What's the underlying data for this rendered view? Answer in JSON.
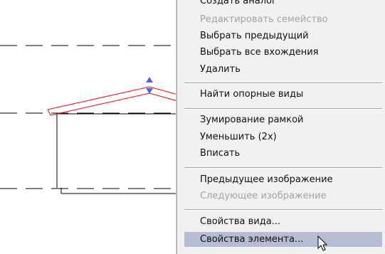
{
  "menu": {
    "items": [
      {
        "label": "Создать аналог",
        "enabled": true
      },
      {
        "label": "Редактировать семейство",
        "enabled": false
      },
      {
        "label": "Выбрать предыдущий",
        "enabled": true
      },
      {
        "label": "Выбрать все вхождения",
        "enabled": true
      },
      {
        "label": "Удалить",
        "enabled": true
      },
      {
        "label": "Найти опорные виды",
        "enabled": true
      },
      {
        "label": "Зумирование рамкой",
        "enabled": true
      },
      {
        "label": "Уменьшить (2x)",
        "enabled": true
      },
      {
        "label": "Вписать",
        "enabled": true
      },
      {
        "label": "Предыдущее изображение",
        "enabled": true
      },
      {
        "label": "Следующее изображение",
        "enabled": false
      },
      {
        "label": "Свойства вида...",
        "enabled": true
      },
      {
        "label": "Свойства элемента...",
        "enabled": true,
        "highlighted": true
      }
    ]
  },
  "colors": {
    "selection_outline": "#ff0000",
    "grip_arrow": "#4a66e0",
    "menu_background": "#f1f1ef",
    "menu_highlight": "#b6bdd2",
    "disabled_text": "#a3a3a3"
  },
  "icons": {
    "grip": "up-down-arrow-icon",
    "cursor": "mouse-pointer-icon"
  }
}
